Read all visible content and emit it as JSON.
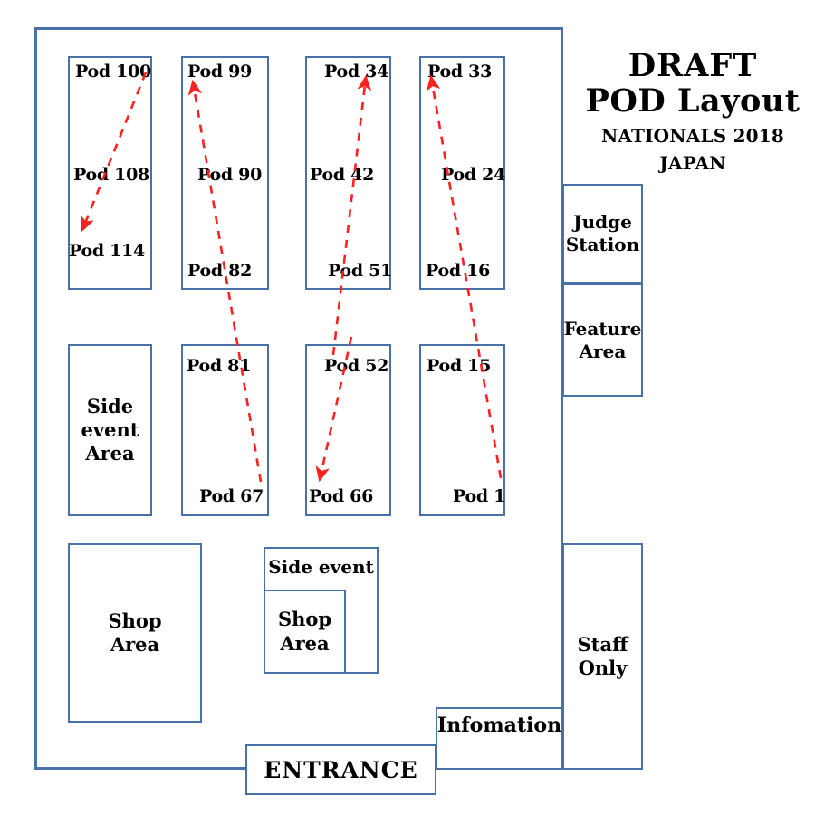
{
  "title": {
    "line1": "DRAFT",
    "line2": "POD Layout",
    "line3": "NATIONALS 2018 JAPAN"
  },
  "colors": {
    "wall": "#4A70A8",
    "arrow": "#FF2020",
    "text": "#000000",
    "background": "#FFFFFF"
  },
  "pod_columns": [
    {
      "id": "column-1",
      "labels": [
        "Pod 100",
        "Pod 108",
        "Pod 114"
      ],
      "arrow": {
        "direction": "down-left",
        "from_pod": "Pod 100",
        "to_pod": "Pod 114"
      }
    },
    {
      "id": "column-2-top",
      "labels": [
        "Pod 99",
        "Pod 90",
        "Pod 82"
      ],
      "arrow": {
        "direction": "up",
        "from_pod": "Pod 67",
        "to_pod": "Pod 99"
      }
    },
    {
      "id": "column-3-top",
      "labels": [
        "Pod 34",
        "Pod 42",
        "Pod 51"
      ],
      "arrow": {
        "direction": "up",
        "from_pod": "Pod 52",
        "to_pod": "Pod 34"
      }
    },
    {
      "id": "column-4-top",
      "labels": [
        "Pod 33",
        "Pod 24",
        "Pod 16"
      ],
      "arrow": {
        "direction": "up",
        "from_pod": "Pod 1",
        "to_pod": "Pod 33"
      }
    },
    {
      "id": "column-2-bottom",
      "labels": [
        "Pod 81",
        "Pod 67"
      ]
    },
    {
      "id": "column-3-bottom",
      "labels": [
        "Pod 52",
        "Pod 66"
      ],
      "arrow": {
        "direction": "down",
        "from_pod": "Pod 52",
        "to_pod": "Pod 66"
      }
    },
    {
      "id": "column-4-bottom",
      "labels": [
        "Pod 15",
        "Pod 1"
      ]
    }
  ],
  "pods": {
    "c1_top": "Pod 100",
    "c1_mid": "Pod 108",
    "c1_bot": "Pod 114",
    "c2_top": "Pod 99",
    "c2_mid": "Pod 90",
    "c2_bot": "Pod 82",
    "c3_top": "Pod 34",
    "c3_mid": "Pod 42",
    "c3_bot": "Pod 51",
    "c4_top": "Pod 33",
    "c4_mid": "Pod 24",
    "c4_bot": "Pod 16",
    "b2_top": "Pod 81",
    "b2_bot": "Pod 67",
    "b3_top": "Pod 52",
    "b3_bot": "Pod 66",
    "b4_top": "Pod 15",
    "b4_bot": "Pod 1"
  },
  "areas": {
    "side_event_area_l1": "Side",
    "side_event_area_l2": "event",
    "side_event_area_l3": "Area",
    "judge_station_l1": "Judge",
    "judge_station_l2": "Station",
    "feature_area_l1": "Feature",
    "feature_area_l2": "Area",
    "shop_area_large_l1": "Shop",
    "shop_area_large_l2": "Area",
    "side_event_small": "Side event",
    "shop_area_small_l1": "Shop",
    "shop_area_small_l2": "Area",
    "staff_only_l1": "Staff",
    "staff_only_l2": "Only",
    "information": "Infomation",
    "entrance": "ENTRANCE"
  }
}
